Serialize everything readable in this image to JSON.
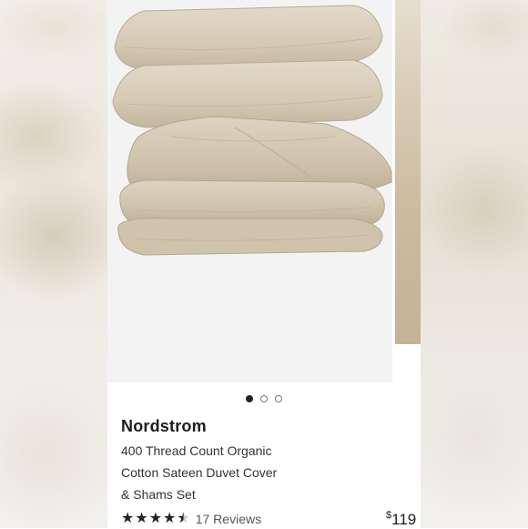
{
  "carousel": {
    "active_index": 0,
    "dots": [
      "dot-1",
      "dot-2",
      "dot-3"
    ]
  },
  "product": {
    "brand": "Nordstrom",
    "name_lines": [
      "400 Thread Count Organic",
      "Cotton Sateen Duvet Cover",
      "& Shams Set"
    ],
    "rating": 4.5,
    "reviews_label": "17 Reviews",
    "price_currency": "$",
    "price_amount": "119"
  },
  "colors": {
    "fabric": "#d8cdb9",
    "fabric_shadow": "#bfb29a",
    "dot_active": "#222222"
  },
  "icons": {
    "star": "star-icon"
  }
}
